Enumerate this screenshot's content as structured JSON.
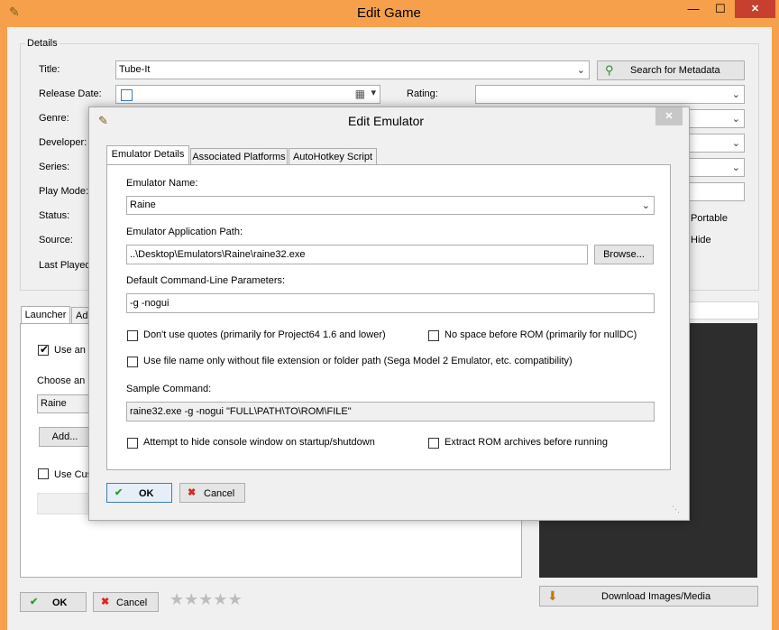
{
  "outer_window": {
    "title": "Edit Game",
    "controls": {
      "minimize": "—",
      "maximize": "☐",
      "close": "✕"
    },
    "details": {
      "legend": "Details",
      "labels": {
        "title": "Title:",
        "release_date": "Release Date:",
        "rating": "Rating:",
        "genre": "Genre:",
        "developer": "Developer:",
        "series": "Series:",
        "play_mode": "Play Mode:",
        "status": "Status:",
        "source": "Source:",
        "last_played": "Last Played"
      },
      "title_value": "Tube-It",
      "search_button": "Search for Metadata",
      "portable_label": "Portable",
      "hide_label": "Hide"
    },
    "tabs": [
      "Launcher",
      "Ad"
    ],
    "launcher": {
      "use_emulator_label": "Use an",
      "choose_label": "Choose an E",
      "emulator_value": "Raine",
      "add_button": "Add...",
      "use_custom_label": "Use Cus"
    },
    "ok_button": "OK",
    "cancel_button": "Cancel",
    "download_button": "Download Images/Media"
  },
  "dialog": {
    "title": "Edit Emulator",
    "close": "✕",
    "tabs": [
      "Emulator Details",
      "Associated Platforms",
      "AutoHotkey Script"
    ],
    "emulator_name_label": "Emulator Name:",
    "emulator_name_value": "Raine",
    "app_path_label": "Emulator Application Path:",
    "app_path_value": "..\\Desktop\\Emulators\\Raine\\raine32.exe",
    "browse_button": "Browse...",
    "params_label": "Default Command-Line Parameters:",
    "params_value": "-g -nogui",
    "options": {
      "no_quotes": "Don't use quotes (primarily for Project64 1.6 and lower)",
      "no_space": "No space before ROM (primarily for nullDC)",
      "file_name_only": "Use file name only without file extension or folder path (Sega Model 2 Emulator, etc. compatibility)",
      "hide_console": "Attempt to hide console window on startup/shutdown",
      "extract_rom": "Extract ROM archives before running"
    },
    "sample_label": "Sample Command:",
    "sample_value": "raine32.exe -g -nogui \"FULL\\PATH\\TO\\ROM\\FILE\"",
    "ok_button": "OK",
    "cancel_button": "Cancel"
  },
  "colors": {
    "accent": "#f6a04b",
    "close_red": "#c7402f",
    "dialog_border": "#aaaaaa"
  }
}
